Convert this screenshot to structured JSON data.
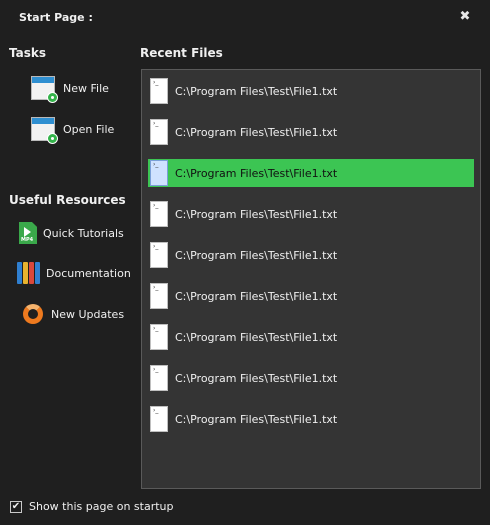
{
  "window": {
    "title": "Start Page :",
    "close_icon": "close-icon"
  },
  "tasks": {
    "heading": "Tasks",
    "items": [
      {
        "label": "New File",
        "icon": "new-file-icon"
      },
      {
        "label": "Open File",
        "icon": "open-file-icon"
      }
    ]
  },
  "resources": {
    "heading": "Useful Resources",
    "items": [
      {
        "label": "Quick Tutorials",
        "icon": "mp4-video-icon"
      },
      {
        "label": "Documentation",
        "icon": "books-icon"
      },
      {
        "label": "New Updates",
        "icon": "refresh-icon"
      }
    ]
  },
  "recent": {
    "heading": "Recent Files",
    "selected_index": 2,
    "selected_color": "#3cc553",
    "files": [
      {
        "path": "C:\\Program Files\\Test\\File1.txt"
      },
      {
        "path": "C:\\Program Files\\Test\\File1.txt"
      },
      {
        "path": "C:\\Program Files\\Test\\File1.txt"
      },
      {
        "path": "C:\\Program Files\\Test\\File1.txt"
      },
      {
        "path": "C:\\Program Files\\Test\\File1.txt"
      },
      {
        "path": "C:\\Program Files\\Test\\File1.txt"
      },
      {
        "path": "C:\\Program Files\\Test\\File1.txt"
      },
      {
        "path": "C:\\Program Files\\Test\\File1.txt"
      },
      {
        "path": "C:\\Program Files\\Test\\File1.txt"
      }
    ]
  },
  "footer": {
    "startup_label": "Show this page on startup",
    "startup_checked": true
  }
}
